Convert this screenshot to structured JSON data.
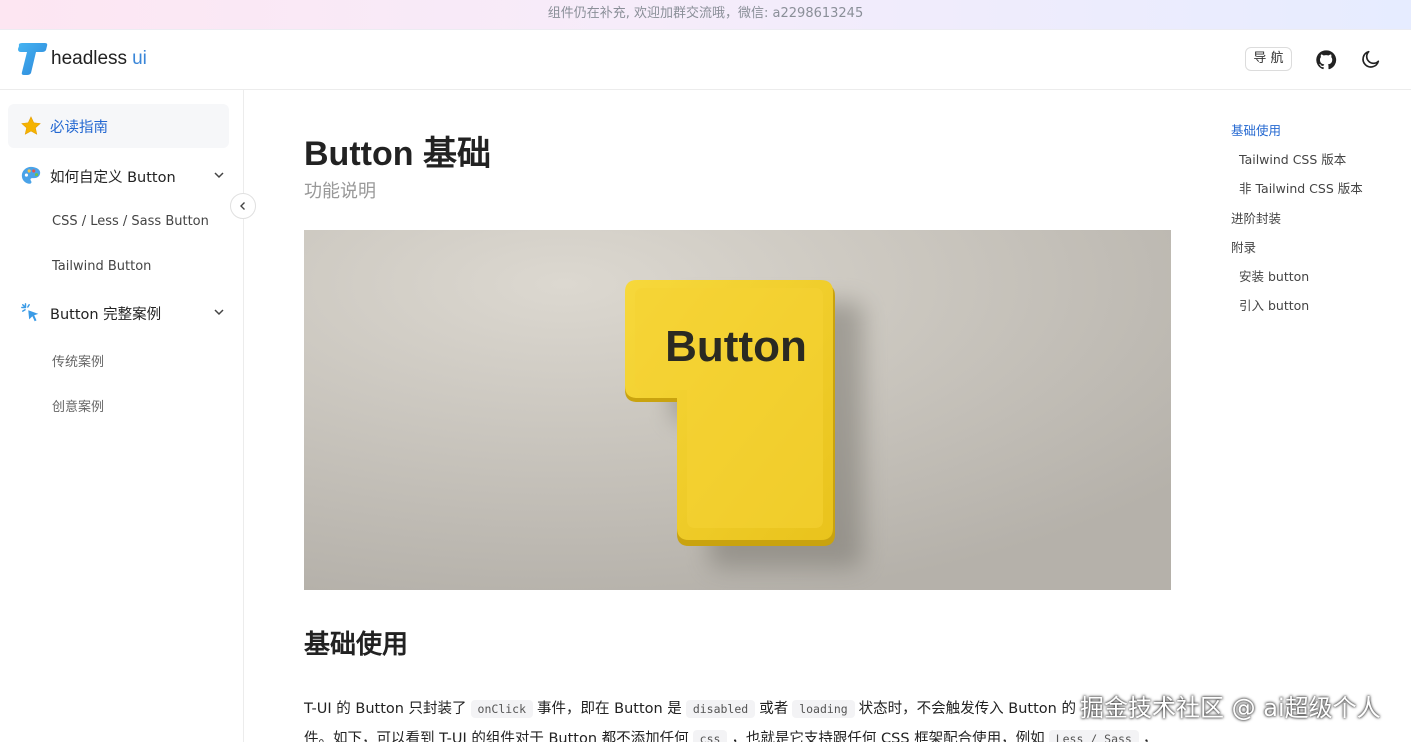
{
  "announcement": "组件仍在补充, 欢迎加群交流哦，微信: a2298613245",
  "header": {
    "logo_letter": "T",
    "logo_text": "headless",
    "logo_text_accent": "ui",
    "nav_label": "导 航",
    "icons": [
      "github-icon",
      "moon-icon"
    ]
  },
  "sidebar": {
    "items": [
      {
        "label": "必读指南",
        "icon": "star-icon",
        "active": true
      },
      {
        "label": "如何自定义 Button",
        "icon": "palette-icon"
      },
      {
        "label": "CSS / Less / Sass Button"
      },
      {
        "label": "Tailwind Button"
      },
      {
        "label": "Button 完整案例",
        "icon": "sparkle-click-icon"
      },
      {
        "label": "传统案例"
      },
      {
        "label": "创意案例"
      }
    ]
  },
  "main": {
    "title": "Button 基础",
    "subtitle": "功能说明",
    "hero_text": "Button",
    "section_title": "基础使用",
    "para": {
      "t1": "T-UI 的 Button 只封装了",
      "c1": "onClick",
      "t2": "事件，即在 Button 是",
      "c2": "disabled",
      "t3": "或者",
      "c3": "loading",
      "t4": "状态时，不会触发传入 Button 的",
      "t5": "件。如下，可以看到 T-UI 的组件对于 Button 都不添加任何",
      "c4": "css",
      "t6": "，也就是它支持跟任何 CSS 框架配合使用，例如",
      "c5": "Less / Sass",
      "t7": "，"
    }
  },
  "toc": [
    {
      "label": "基础使用",
      "level": 1,
      "active": true
    },
    {
      "label": "Tailwind CSS 版本",
      "level": 2
    },
    {
      "label": "非 Tailwind CSS 版本",
      "level": 2
    },
    {
      "label": "进阶封装",
      "level": 1
    },
    {
      "label": "附录",
      "level": 1
    },
    {
      "label": "安装 button",
      "level": 2
    },
    {
      "label": "引入 button",
      "level": 2
    }
  ],
  "watermark": "掘金技术社区 @ ai超级个人",
  "colors": {
    "accent": "#2468d1",
    "logo": "#3a9be6",
    "button_yellow": "#f2cf2a"
  }
}
